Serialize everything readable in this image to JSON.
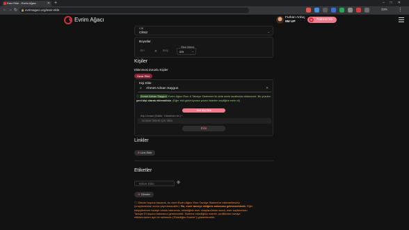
{
  "browser": {
    "tab_title": "Eser Ekle - Evrim Ağacı",
    "url": "evrimagaci.org/eser-ekle",
    "zoom": "33%"
  },
  "header": {
    "brand": "Evrim Ağacı",
    "user_name": "Furkan Arduç",
    "user_points": "9M UP",
    "supporter_label": "Patreon'da"
  },
  "form": {
    "cilt_label": "Cilt",
    "cilt_value": "Ciltsiz",
    "boyutlar_label": "Boyutlar",
    "olcu_birimi_label": "Ölçü Birimi",
    "en_placeholder": "En",
    "boy_placeholder": "Boy",
    "unit_value": "cm",
    "times": "✕"
  },
  "kisiler": {
    "title": "Kişiler",
    "subtitle": "Eklenmesi Zorunlu Kişiler",
    "yazar_pill": "Yazar Ekle",
    "kisi_ekle_label": "Kişi Ekle",
    "search_value": "Ahmet Adnan Saygun",
    "info_name": "Ahmet Adnan Saygun",
    "info_text1": "Evrim Ağacı Eser & Taksiye Sistemine",
    "info_text2": "ilk defa senin tarafından",
    "info_text3": "eklenecek. Bu yüzden",
    "info_bold": "yeni kişi olarak eklemelisin",
    "info_text4": ". (Eğer ekli görünüyorsa yukarı listeden seçtiğine emin ol)",
    "yeni_kisi_btn": "Yeni Kişi Ekle",
    "unvan_label": "Kişi Unvanı (Editör, Yönetmen vb.)",
    "unvan_placeholder": "Unvan listesi için tıkla",
    "ekle_btn": "Ekle"
  },
  "linkler": {
    "title": "Linkler",
    "link_ekle": "Link Ekle"
  },
  "etiketler": {
    "title": "Etiketler",
    "etiket_placeholder": "Etiket Ekle",
    "gonder_btn": "Gönder",
    "notice_line1": "Gönder tuşuna basarak, bu eseri Evrim Ağacı Eser Tavsiye Sistemi'ne eklemektesiniz",
    "notice_line2_a": "(onaylandıktan sonra yayınlanacaktır).",
    "notice_line2_b": "Bu, eseri tavsiye ettiğiniz anlamına gelmemektedir.",
    "notice_line2_c": "Eğer",
    "notice_line3": "takipçilerinize tavsiye etmek isterseniz, eklediğiniz eser onaylandıktan sonra, eser sayfasından",
    "notice_line4": "Tavsiye Et tuşuna basmanız gerekecektir. Sisteme eklediğiniz eserler, profilinizde tavsiye",
    "notice_line5": "ettiklerinizden ayrı bir sekmede (\"Eklediğim Eserler\") gösterilecektir."
  },
  "colors": {
    "accent": "#d03040",
    "pink": "#f07b8c",
    "notice": "#ff8a3d",
    "info_green": "#9ad07a"
  }
}
